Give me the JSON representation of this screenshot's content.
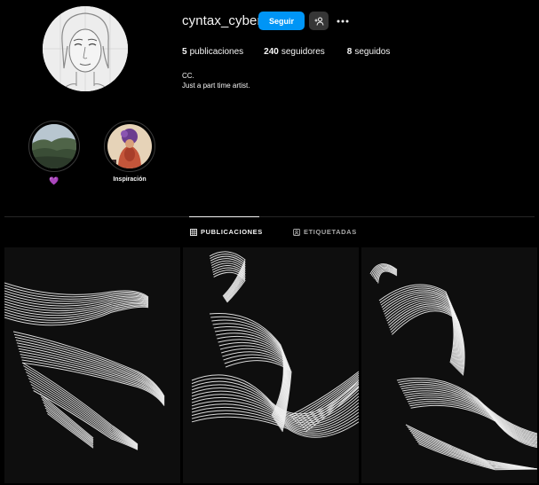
{
  "profile": {
    "username": "cyntax_cyber",
    "follow_label": "Seguir",
    "suggest_icon": "person-add-icon",
    "more_icon": "more-horizontal-icon",
    "avatar_icon": "profile-sketch-avatar"
  },
  "stats": {
    "posts_count": "5",
    "posts_label": "publicaciones",
    "followers_count": "240",
    "followers_label": "seguidores",
    "following_count": "8",
    "following_label": "seguidos"
  },
  "bio": {
    "name": "CC.",
    "text": "Just a part time artist."
  },
  "highlights": [
    {
      "label": "💜",
      "icon": "landscape-thumbnail"
    },
    {
      "label": "Inspiración",
      "icon": "artwork-thumbnail"
    }
  ],
  "tabs": [
    {
      "label": "PUBLICACIONES",
      "icon": "grid-icon",
      "active": true
    },
    {
      "label": "ETIQUETADAS",
      "icon": "tagged-icon",
      "active": false
    }
  ],
  "posts": [
    {
      "subject": "hand line art"
    },
    {
      "subject": "figure line art"
    },
    {
      "subject": "face line art"
    }
  ],
  "colors": {
    "background": "#000000",
    "accent": "#0095f6",
    "secondary_button": "#363636",
    "heart": "#a259f7"
  }
}
